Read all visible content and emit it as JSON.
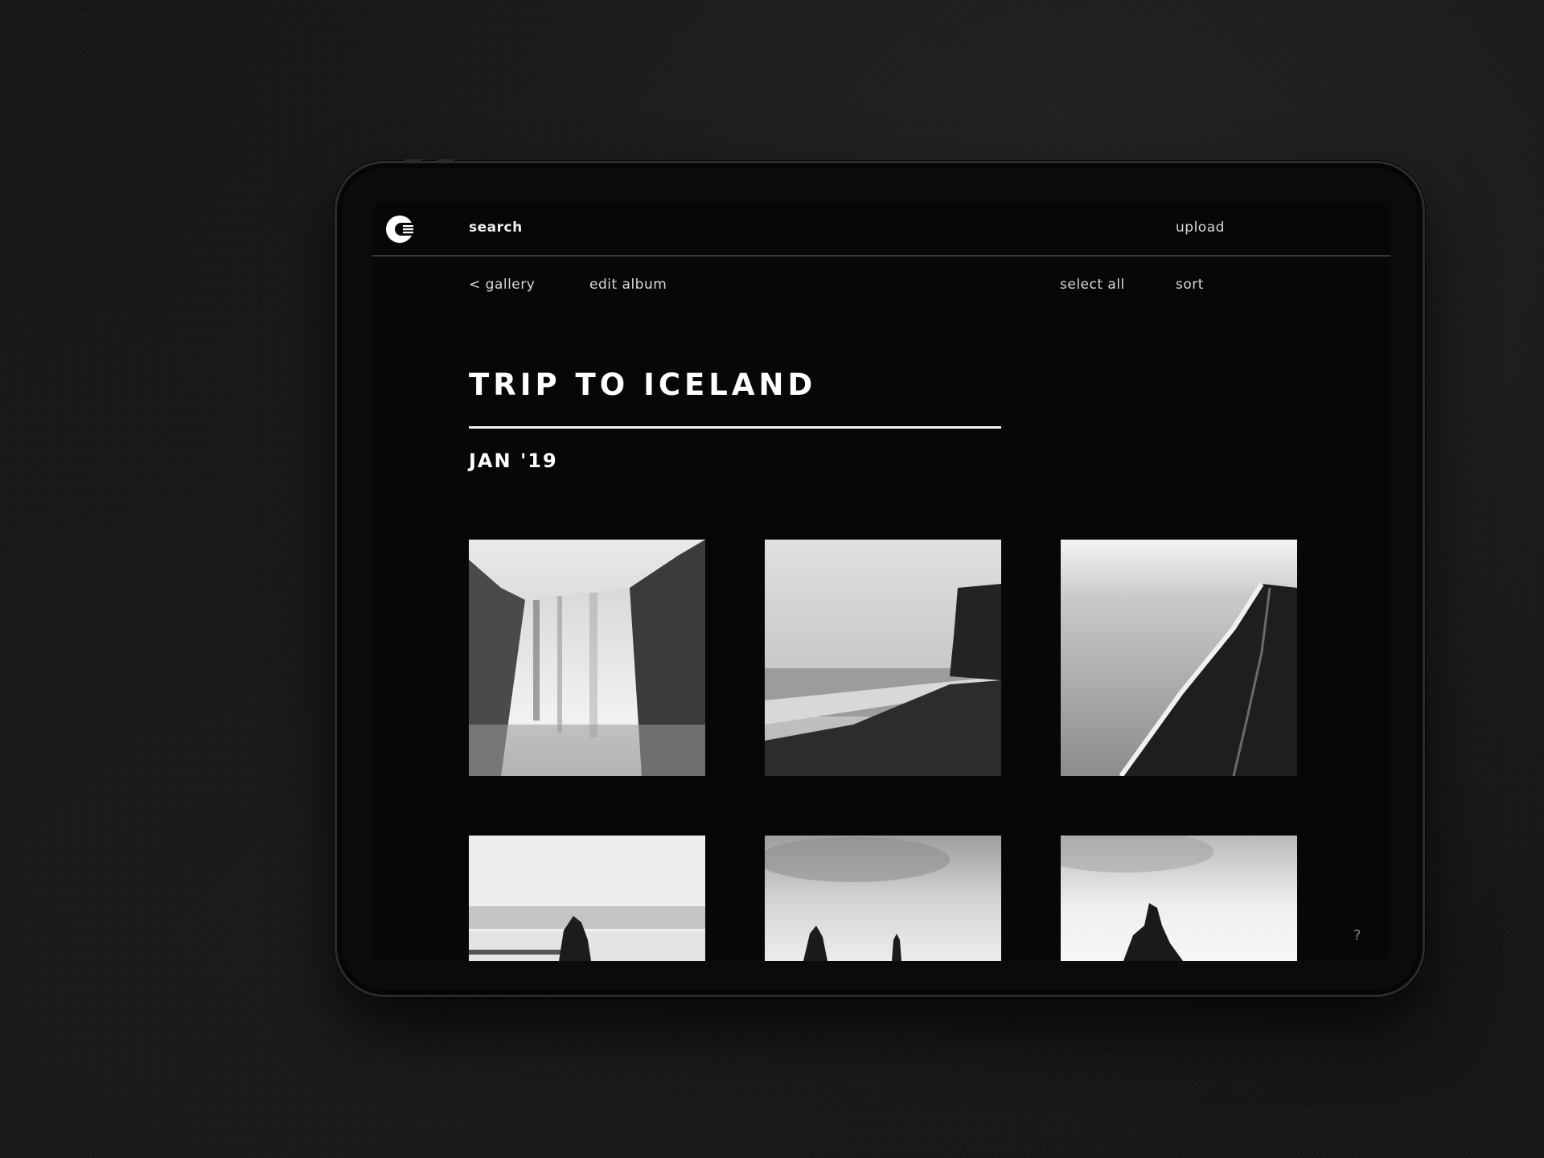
{
  "header": {
    "search_label": "search",
    "upload_label": "upload"
  },
  "subnav": {
    "back_label": "< gallery",
    "edit_label": "edit album",
    "select_all_label": "select all",
    "sort_label": "sort"
  },
  "album": {
    "title": "TRIP TO ICELAND",
    "date": "JAN '19"
  },
  "photos": [
    {
      "subject": "waterfall"
    },
    {
      "subject": "black-sand-beach-cliff"
    },
    {
      "subject": "aerial-coastline"
    },
    {
      "subject": "sea-stack-shore"
    },
    {
      "subject": "sea-stacks-cloudy"
    },
    {
      "subject": "sea-stack-sky"
    }
  ],
  "help_label": "?",
  "icons": {
    "logo": "c-logo-icon",
    "help": "question-mark-icon"
  },
  "colors": {
    "background": "#070707",
    "text": "#ffffff",
    "divider": "#3a3a3a"
  }
}
